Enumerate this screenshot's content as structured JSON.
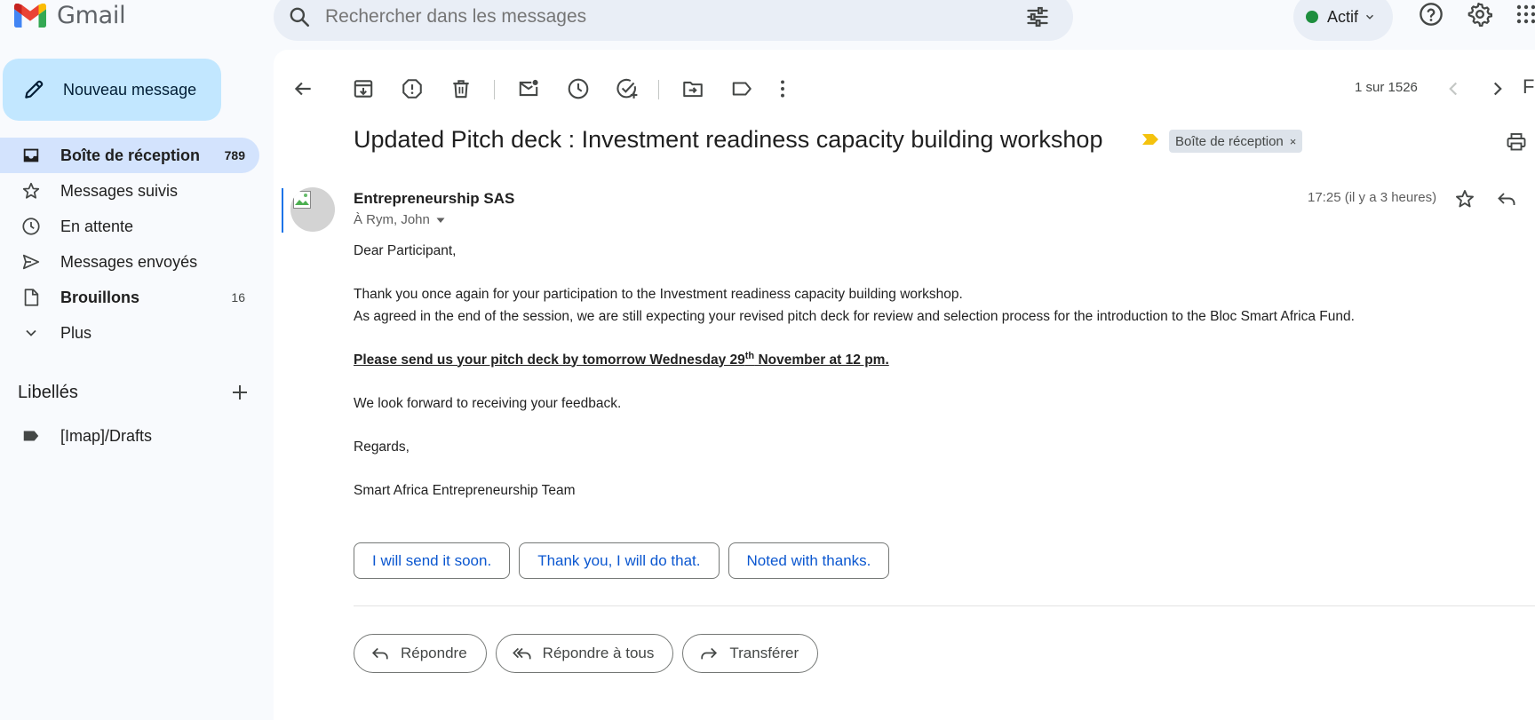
{
  "app": {
    "name": "Gmail"
  },
  "search": {
    "placeholder": "Rechercher dans les messages"
  },
  "status": {
    "label": "Actif",
    "color": "#1e8e3e"
  },
  "sidebar": {
    "compose_label": "Nouveau message",
    "items": [
      {
        "label": "Boîte de réception",
        "count": "789",
        "icon": "inbox-icon"
      },
      {
        "label": "Messages suivis",
        "count": "",
        "icon": "star-icon"
      },
      {
        "label": "En attente",
        "count": "",
        "icon": "clock-icon"
      },
      {
        "label": "Messages envoyés",
        "count": "",
        "icon": "send-icon"
      },
      {
        "label": "Brouillons",
        "count": "16",
        "icon": "draft-icon"
      },
      {
        "label": "Plus",
        "count": "",
        "icon": "chevron-down-icon"
      }
    ],
    "labels_title": "Libellés",
    "labels": [
      {
        "label": "[Imap]/Drafts",
        "icon": "label-icon"
      }
    ]
  },
  "toolbar": {
    "pager": "1 sur 1526",
    "trailing_letter": "F"
  },
  "email": {
    "subject": "Updated Pitch deck : Investment readiness capacity building workshop",
    "tag": "Boîte de réception",
    "tag_close": "×",
    "sender": "Entrepreneurship SAS",
    "recipients": "À Rym, John",
    "time": "17:25 (il y a 3 heures)",
    "body": {
      "greeting": "Dear Participant,",
      "line1": "Thank you once again for your participation to the Investment readiness capacity building workshop.",
      "line2": "As agreed in the end of the session, we are still expecting your revised pitch deck for review and selection process for the introduction to the Bloc Smart Africa Fund.",
      "urgent_before": "Please send us your pitch deck by tomorrow Wednesday 29",
      "urgent_sup": "th",
      "urgent_after": " November at 12 pm.",
      "feedback": "We look forward to receiving your feedback.",
      "closing": "Regards,",
      "signature": "Smart Africa Entrepreneurship Team"
    }
  },
  "smart_replies": [
    "I will send it soon.",
    "Thank you, I will do that.",
    "Noted with thanks."
  ],
  "actions": {
    "reply": "Répondre",
    "reply_all": "Répondre à tous",
    "forward": "Transférer"
  },
  "colors": {
    "accent": "#0b57d0",
    "compose_bg": "#c2e7ff",
    "active_nav": "#d3e3fd",
    "importance": "#f4c20d"
  }
}
